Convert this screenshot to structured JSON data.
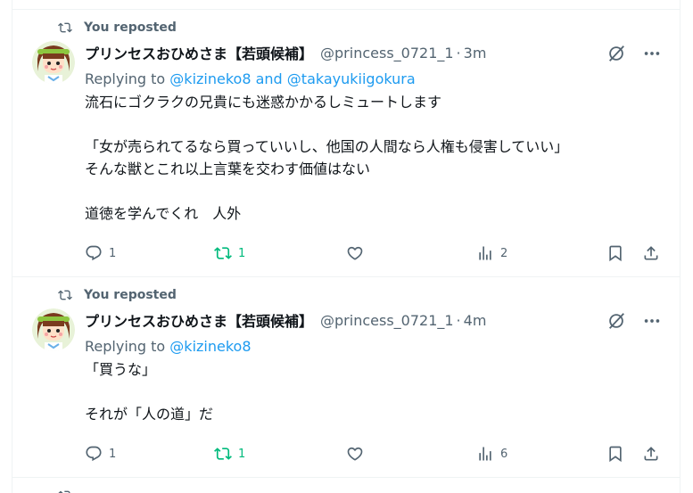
{
  "colors": {
    "text": "#0f1419",
    "secondary": "#536471",
    "link": "#1d9bf0",
    "repost_active": "#00ba7c",
    "divider": "#eff3f4"
  },
  "tweets": [
    {
      "repost_label": "You reposted",
      "display_name": "プリンセスおひめさま【若頭候補】",
      "handle": "@princess_0721_1",
      "separator": "·",
      "time": "3m",
      "replying_prefix": "Replying to",
      "replying_mentions": [
        "@kizineko8",
        "@takayukiigokura"
      ],
      "replying_joiner": "and",
      "body_lines": [
        "流石にゴクラクの兄貴にも迷惑かかるしミュートします",
        "",
        "「女が売られてるなら買っていいし、他国の人間なら人権も侵害していい」",
        "そんな獣とこれ以上言葉を交わす価値はない",
        "",
        "道徳を学んでくれ　人外"
      ],
      "stats": {
        "replies": "1",
        "reposts": "1",
        "likes": "",
        "views": "2"
      },
      "icons": {
        "repost": "repost-icon",
        "grok": "grok-icon",
        "more": "more-icon",
        "reply": "reply-icon",
        "like": "heart-icon",
        "views": "views-icon",
        "bookmark": "bookmark-icon",
        "share": "share-icon"
      }
    },
    {
      "repost_label": "You reposted",
      "display_name": "プリンセスおひめさま【若頭候補】",
      "handle": "@princess_0721_1",
      "separator": "·",
      "time": "4m",
      "replying_prefix": "Replying to",
      "replying_mentions": [
        "@kizineko8"
      ],
      "replying_joiner": "",
      "body_lines": [
        "「買うな」",
        "",
        "それが「人の道」だ"
      ],
      "stats": {
        "replies": "1",
        "reposts": "1",
        "likes": "",
        "views": "6"
      },
      "icons": {
        "repost": "repost-icon",
        "grok": "grok-icon",
        "more": "more-icon",
        "reply": "reply-icon",
        "like": "heart-icon",
        "views": "views-icon",
        "bookmark": "bookmark-icon",
        "share": "share-icon"
      }
    }
  ]
}
